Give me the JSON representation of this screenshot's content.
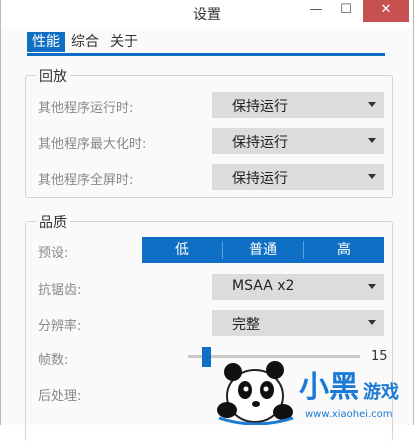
{
  "window": {
    "title": "设置",
    "minimize_glyph": "—",
    "maximize_glyph": "☐",
    "close_glyph": "✕"
  },
  "tabs": [
    {
      "label": "性能",
      "active": true
    },
    {
      "label": "综合",
      "active": false
    },
    {
      "label": "关于",
      "active": false
    }
  ],
  "playback": {
    "title": "回放",
    "rows": [
      {
        "label": "其他程序运行时:",
        "value": "保持运行"
      },
      {
        "label": "其他程序最大化时:",
        "value": "保持运行"
      },
      {
        "label": "其他程序全屏时:",
        "value": "保持运行"
      }
    ]
  },
  "quality": {
    "title": "品质",
    "preset_label": "预设:",
    "preset_options": [
      "低",
      "普通",
      "高"
    ],
    "antialias_label": "抗锯齿:",
    "antialias_value": "MSAA x2",
    "resolution_label": "分辨率:",
    "resolution_value": "完整",
    "fps_label": "帧数:",
    "fps_value": "15",
    "postprocess_label": "后处理:",
    "next_label_partial": "..."
  },
  "watermark": {
    "text_main": "小黑",
    "text_sub": "游戏",
    "url": "www.xiaohei.com"
  },
  "colors": {
    "accent": "#0e6fc5",
    "close_button": "#c75050",
    "select_bg": "#dcdcdc"
  }
}
